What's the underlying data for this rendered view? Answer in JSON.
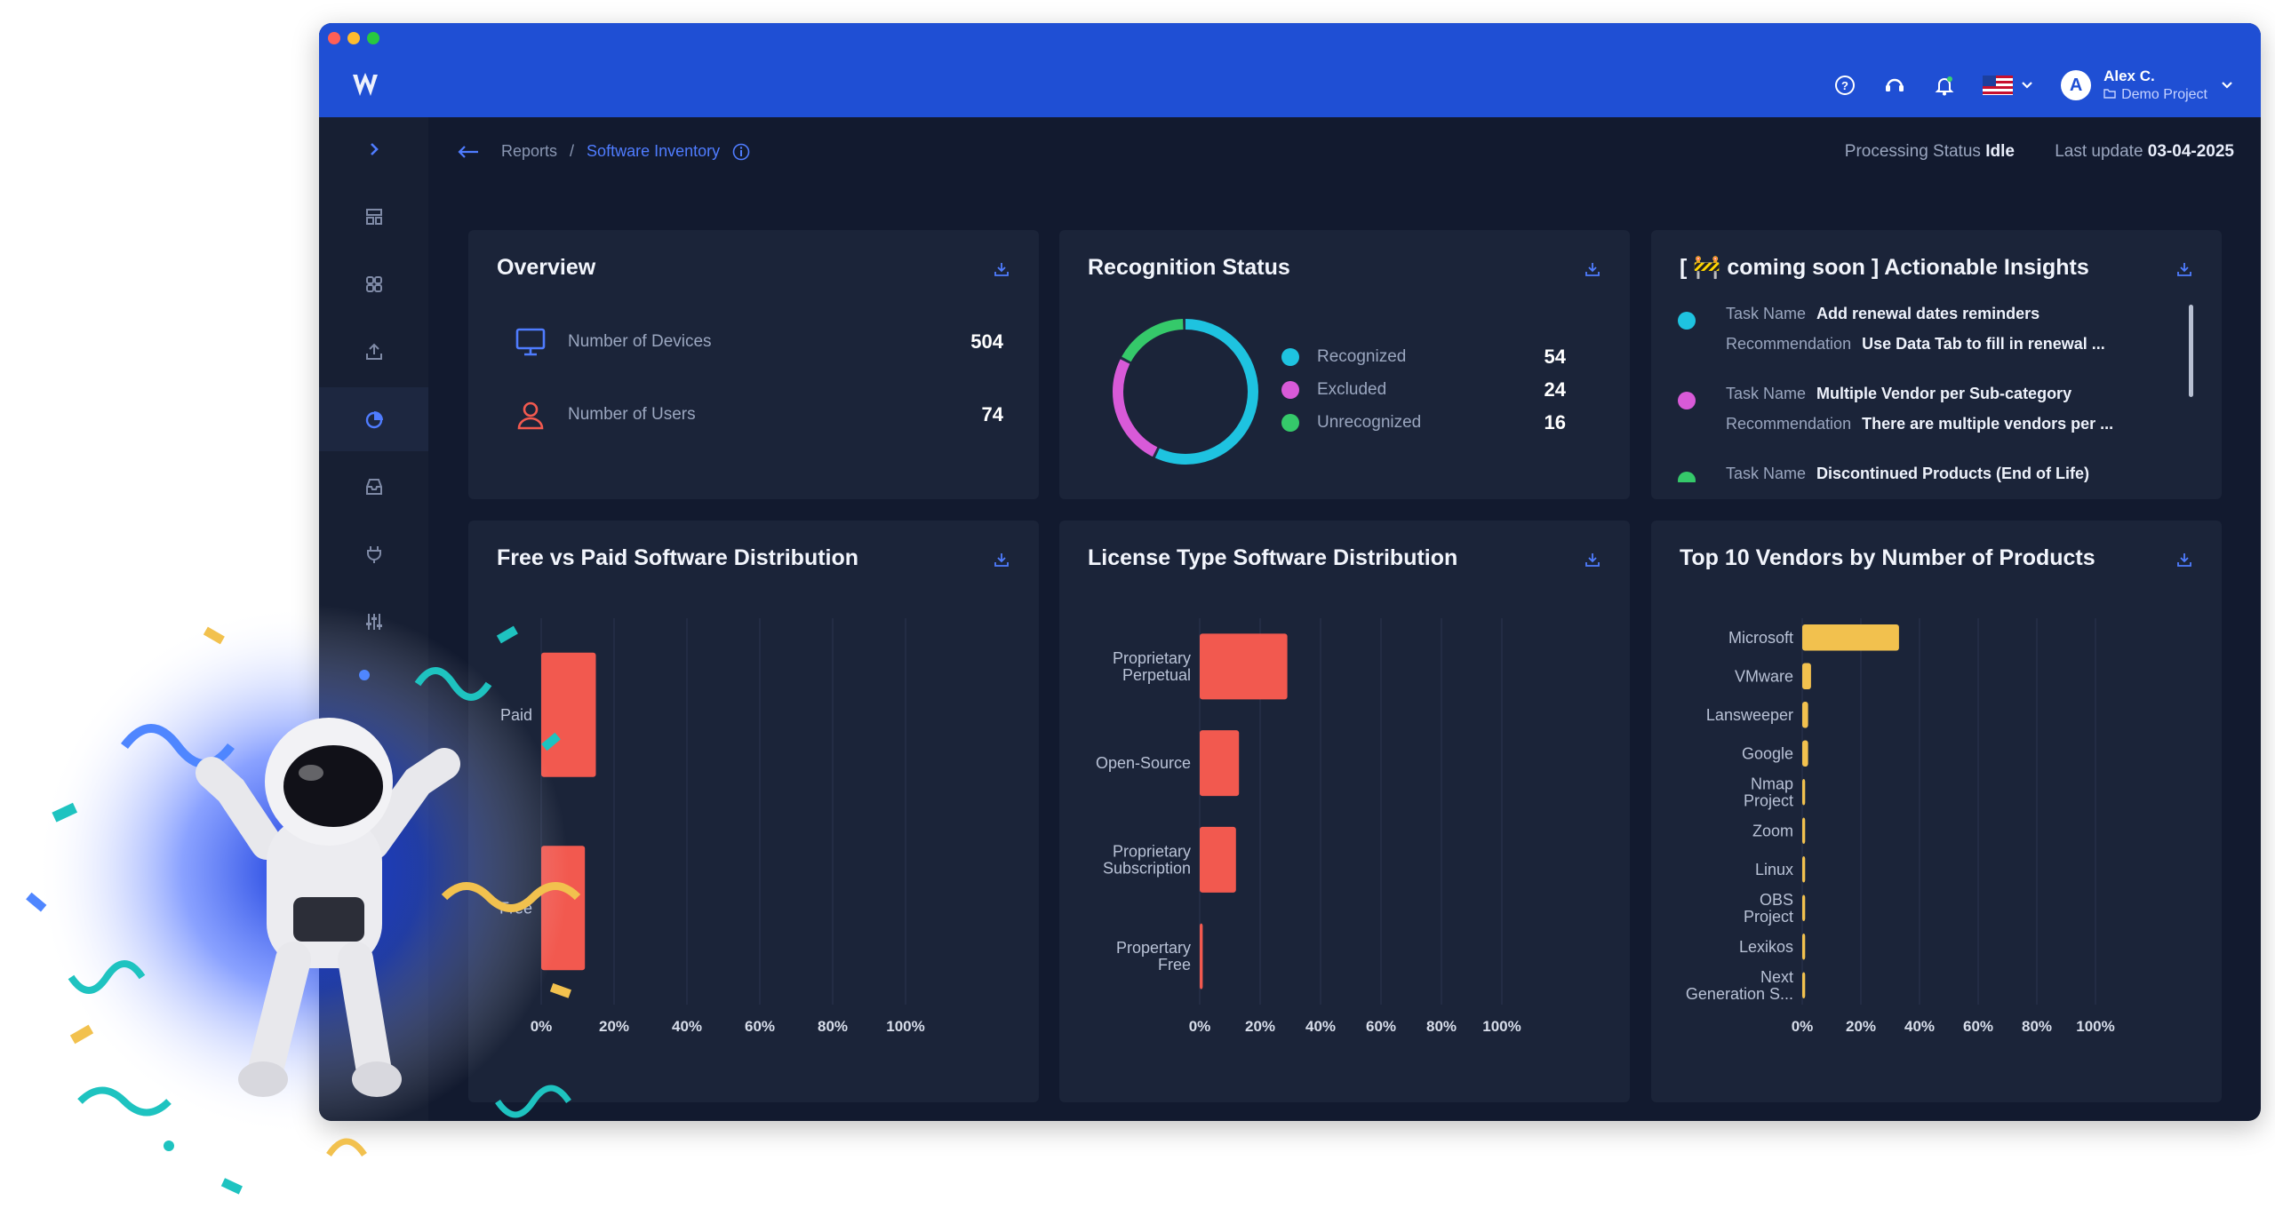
{
  "header": {
    "user_name": "Alex C.",
    "project": "Demo Project",
    "avatar_letter": "A",
    "icons": [
      "help-icon",
      "support-icon",
      "bell-icon",
      "us-flag-icon",
      "chevron-down-icon"
    ],
    "brand_color": "#1f4fd4"
  },
  "sidebar": {
    "items": [
      "expand-icon",
      "layout-icon",
      "apps-icon",
      "upload-icon",
      "reports-icon",
      "inbox-icon",
      "plug-icon",
      "sliders-icon"
    ],
    "active": "reports-icon"
  },
  "breadcrumb": {
    "root": "Reports",
    "separator": "/",
    "current": "Software Inventory"
  },
  "status": {
    "processing_label": "Processing Status",
    "processing_value": "Idle",
    "update_label": "Last update",
    "update_value": "03-04-2025"
  },
  "overview": {
    "title": "Overview",
    "rows": [
      {
        "label": "Number of Devices",
        "value": "504",
        "icon": "monitor-icon"
      },
      {
        "label": "Number of Users",
        "value": "74",
        "icon": "user-icon"
      }
    ]
  },
  "recognition": {
    "title": "Recognition Status",
    "items": [
      {
        "label": "Recognized",
        "value": "54",
        "color": "#1ec3e0"
      },
      {
        "label": "Excluded",
        "value": "24",
        "color": "#d85ad8"
      },
      {
        "label": "Unrecognized",
        "value": "16",
        "color": "#35c96a"
      }
    ]
  },
  "insights": {
    "title": "[ 🚧 coming soon ] Actionable Insights",
    "task_label": "Task Name",
    "rec_label": "Recommendation",
    "items": [
      {
        "task": "Add renewal dates reminders",
        "rec": "Use Data Tab to fill in renewal ...",
        "color": "#1ec3e0"
      },
      {
        "task": "Multiple Vendor per Sub-category",
        "rec": "There are multiple vendors per ...",
        "color": "#d85ad8"
      },
      {
        "task": "Discontinued Products (End of Life)",
        "rec": "",
        "color": "#35c96a"
      }
    ]
  },
  "chart_titles": {
    "free_paid": "Free vs Paid Software Distribution",
    "license": "License Type Software Distribution",
    "vendors": "Top 10 Vendors by Number of Products"
  },
  "chart_data": [
    {
      "type": "bar",
      "orientation": "horizontal",
      "title": "Free vs Paid Software Distribution",
      "categories": [
        "Paid",
        "Free"
      ],
      "values": [
        15,
        12
      ],
      "xticks": [
        "0%",
        "20%",
        "40%",
        "60%",
        "80%",
        "100%"
      ],
      "xlim": [
        0,
        100
      ],
      "color": "#f2594f"
    },
    {
      "type": "bar",
      "orientation": "horizontal",
      "title": "License Type Software Distribution",
      "categories": [
        "Proprietary\nPerpetual",
        "Open-Source",
        "Proprietary\nSubscription",
        "Propertary\nFree"
      ],
      "values": [
        29,
        13,
        12,
        1
      ],
      "xticks": [
        "0%",
        "20%",
        "40%",
        "60%",
        "80%",
        "100%"
      ],
      "xlim": [
        0,
        100
      ],
      "color": "#f2594f"
    },
    {
      "type": "bar",
      "orientation": "horizontal",
      "title": "Top 10 Vendors by Number of Products",
      "categories": [
        "Microsoft",
        "VMware",
        "Lansweeper",
        "Google",
        "Nmap\nProject",
        "Zoom",
        "Linux",
        "OBS\nProject",
        "Lexikos",
        "Next\nGeneration S..."
      ],
      "values": [
        33,
        3,
        2,
        2,
        1,
        1,
        1,
        1,
        1,
        1
      ],
      "xticks": [
        "0%",
        "20%",
        "40%",
        "60%",
        "80%",
        "100%"
      ],
      "xlim": [
        0,
        100
      ],
      "color": "#f2c14e"
    }
  ]
}
